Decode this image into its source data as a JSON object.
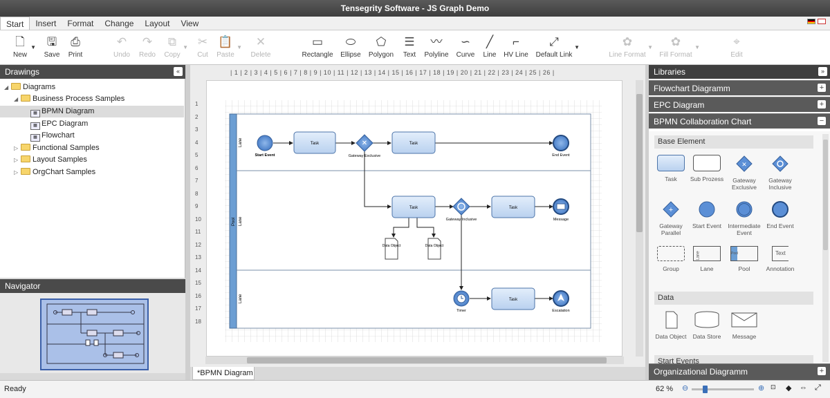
{
  "app": {
    "title": "Tensegrity Software - JS Graph Demo"
  },
  "menu": [
    "Start",
    "Insert",
    "Format",
    "Change",
    "Layout",
    "View"
  ],
  "toolbar": {
    "new": "New",
    "save": "Save",
    "print": "Print",
    "undo": "Undo",
    "redo": "Redo",
    "copy": "Copy",
    "cut": "Cut",
    "paste": "Paste",
    "delete": "Delete",
    "rectangle": "Rectangle",
    "ellipse": "Ellipse",
    "polygon": "Polygon",
    "text": "Text",
    "polyline": "Polyline",
    "curve": "Curve",
    "line": "Line",
    "hvline": "HV Line",
    "default_link": "Default Link",
    "line_format": "Line Format",
    "fill_format": "Fill Format",
    "edit": "Edit"
  },
  "drawings": {
    "title": "Drawings",
    "tree": [
      {
        "label": "Diagrams"
      },
      {
        "label": "Business Process Samples"
      },
      {
        "label": "BPMN Diagram"
      },
      {
        "label": "EPC Diagram"
      },
      {
        "label": "Flowchart"
      },
      {
        "label": "Functional Samples"
      },
      {
        "label": "Layout Samples"
      },
      {
        "label": "OrgChart Samples"
      }
    ]
  },
  "navigator": {
    "title": "Navigator"
  },
  "ruler": {
    "h": "| 1 | 2 | 3 | 4 | 5 | 6 | 7 | 8 | 9 | 10 | 11 | 12 | 13 | 14 | 15 | 16 | 17 | 18 | 19 | 20 | 21 | 22 | 23 | 24 | 25 | 26 |",
    "v": [
      "1",
      "2",
      "3",
      "4",
      "5",
      "6",
      "7",
      "8",
      "9",
      "10",
      "11",
      "12",
      "13",
      "14",
      "15",
      "16",
      "17",
      "18"
    ]
  },
  "diagram": {
    "pool": "Pool",
    "lane": "Lane",
    "start_event": "Start Event",
    "task": "Task",
    "gateway_exclusive": "Gateway Exclusive",
    "end_event": "End Event",
    "gateway_inclusive": "Gateway Inclusive",
    "message": "Message",
    "data_object": "Data Object",
    "timer": "Timer",
    "escalation": "Escalation"
  },
  "doc_tab": "*BPMN Diagram",
  "libraries": {
    "title": "Libraries",
    "flowchart": "Flowchart Diagramm",
    "epc": "EPC Diagram",
    "bpmn": "BPMN Collaboration Chart",
    "org": "Organizational Diagramm",
    "base_element": "Base Element",
    "data": "Data",
    "start_events": "Start Events",
    "base_items": [
      "Task",
      "Sub Prozess",
      "Gateway Exclusive",
      "Gateway Inclusive",
      "Gateway Parallel",
      "Start Event",
      "Intermediate Event",
      "End Event",
      "Group",
      "Lane",
      "Pool",
      "Annotation"
    ],
    "pool_label": "Pool",
    "lane_label": "Lane",
    "text_label": "Text",
    "data_items": [
      "Data Object",
      "Data Store",
      "Message"
    ]
  },
  "status": {
    "ready": "Ready",
    "zoom": "62 %"
  },
  "colors": {
    "task_fill": "#cfe0f5",
    "event_blue": "#5b8fd6",
    "pool_bar": "#6c9ed3",
    "panel_dark": "#4a4a4a"
  }
}
